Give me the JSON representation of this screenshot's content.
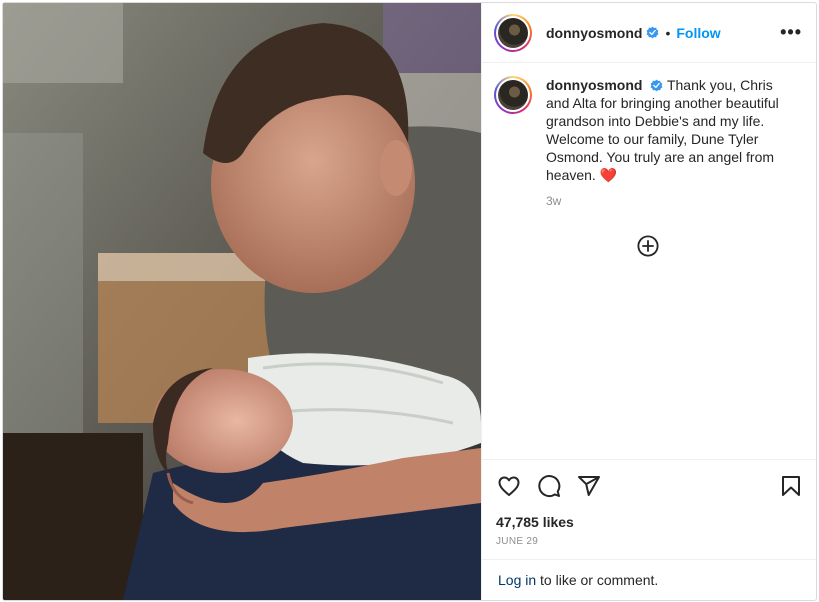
{
  "header": {
    "username": "donnyosmond",
    "separator": "•",
    "follow_label": "Follow",
    "more_label": "•••"
  },
  "caption": {
    "username": "donnyosmond",
    "text": "Thank you, Chris and Alta for bringing another beautiful grandson into Debbie's and my life. Welcome to our family, Dune Tyler Osmond. You truly are an angel from heaven. ❤️",
    "age": "3w"
  },
  "actions": {
    "icons": [
      "heart-icon",
      "comment-icon",
      "share-icon",
      "bookmark-icon"
    ]
  },
  "likes": "47,785 likes",
  "date": "JUNE 29",
  "login": {
    "link": "Log in",
    "rest": " to like or comment."
  },
  "colors": {
    "accent": "#0095f6",
    "verified": "#3897f0",
    "muted": "#8e8e8e",
    "link": "#00376b"
  }
}
